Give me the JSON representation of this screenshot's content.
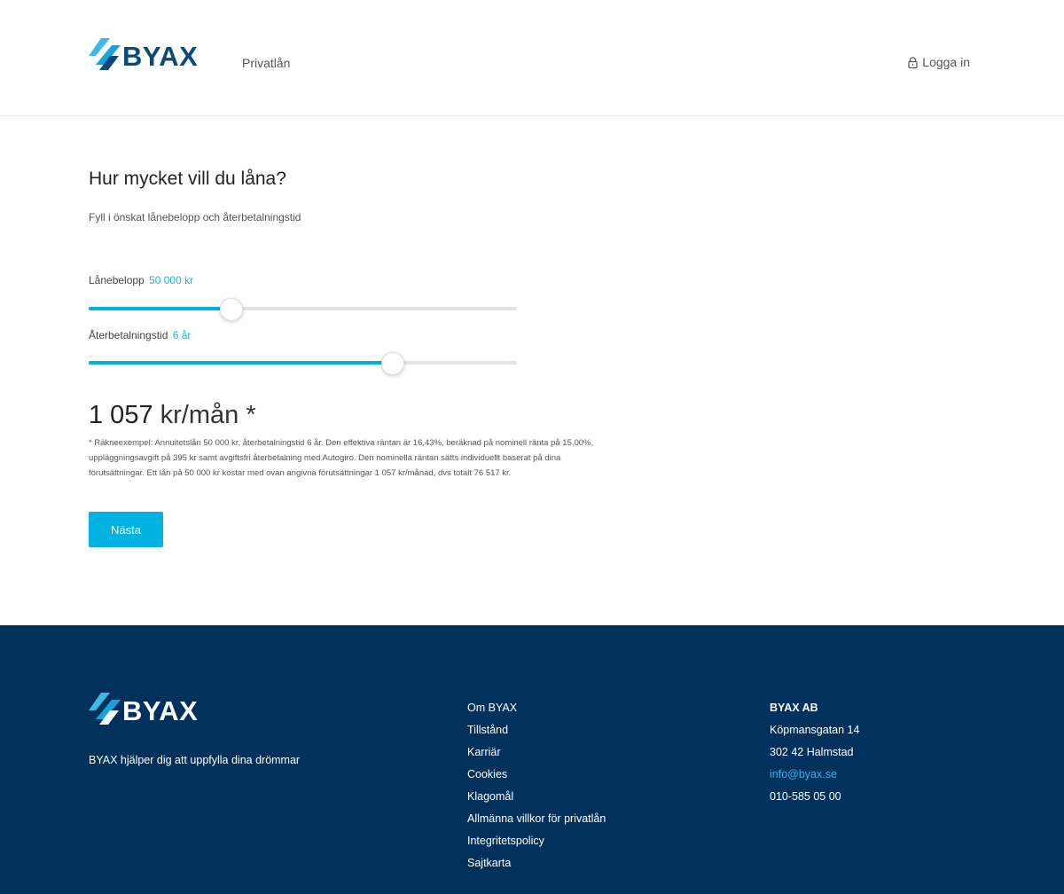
{
  "brand": {
    "name": "BYAX",
    "primary_color": "#0a4a78",
    "accent_color": "#00b2e1",
    "footer_bg": "#00315c"
  },
  "header": {
    "nav_item": "Privatlån",
    "login_label": "Logga in",
    "login_icon": "lock-icon"
  },
  "main": {
    "title": "Hur mycket vill du låna?",
    "subtitle": "Fyll i önskat lånebelopp och återbetalningstid",
    "amount": {
      "label": "Lånebelopp",
      "value_text": "50 000 kr",
      "fraction": 0.333
    },
    "term": {
      "label": "Återbetalningstid",
      "value_text": "6 år",
      "fraction": 0.71
    },
    "monthly_value": "1 057",
    "monthly_unit": "kr/mån *",
    "disclaimer": "* Räkneexempel: Annuitetslån 50 000 kr, återbetalningstid 6 år. Den effektiva räntan är 16,43%, beräknad på nominell ränta på 15,00%, uppläggningsavgift på 395 kr samt avgiftsfri återbetalning med Autogiro. Den nominella räntan sätts individuellt baserat på dina förutsättningar. Ett lån på 50 000 kr kostar med ovan angivna förutsättningar 1 057 kr/månad, dvs totalt 76 517 kr.",
    "next_button": "Nästa"
  },
  "footer": {
    "tagline": "BYAX hjälper dig att uppfylla dina drömmar",
    "links": [
      "Om BYAX",
      "Tillstånd",
      "Karriär",
      "Cookies",
      "Klagomål",
      "Allmänna villkor för privatlån",
      "Integritetspolicy",
      "Sajtkarta"
    ],
    "contact": {
      "company": "BYAX AB",
      "street": "Köpmansgatan 14",
      "city": "302 42 Halmstad",
      "email": "info@byax.se",
      "phone": "010-585 05 00"
    }
  }
}
